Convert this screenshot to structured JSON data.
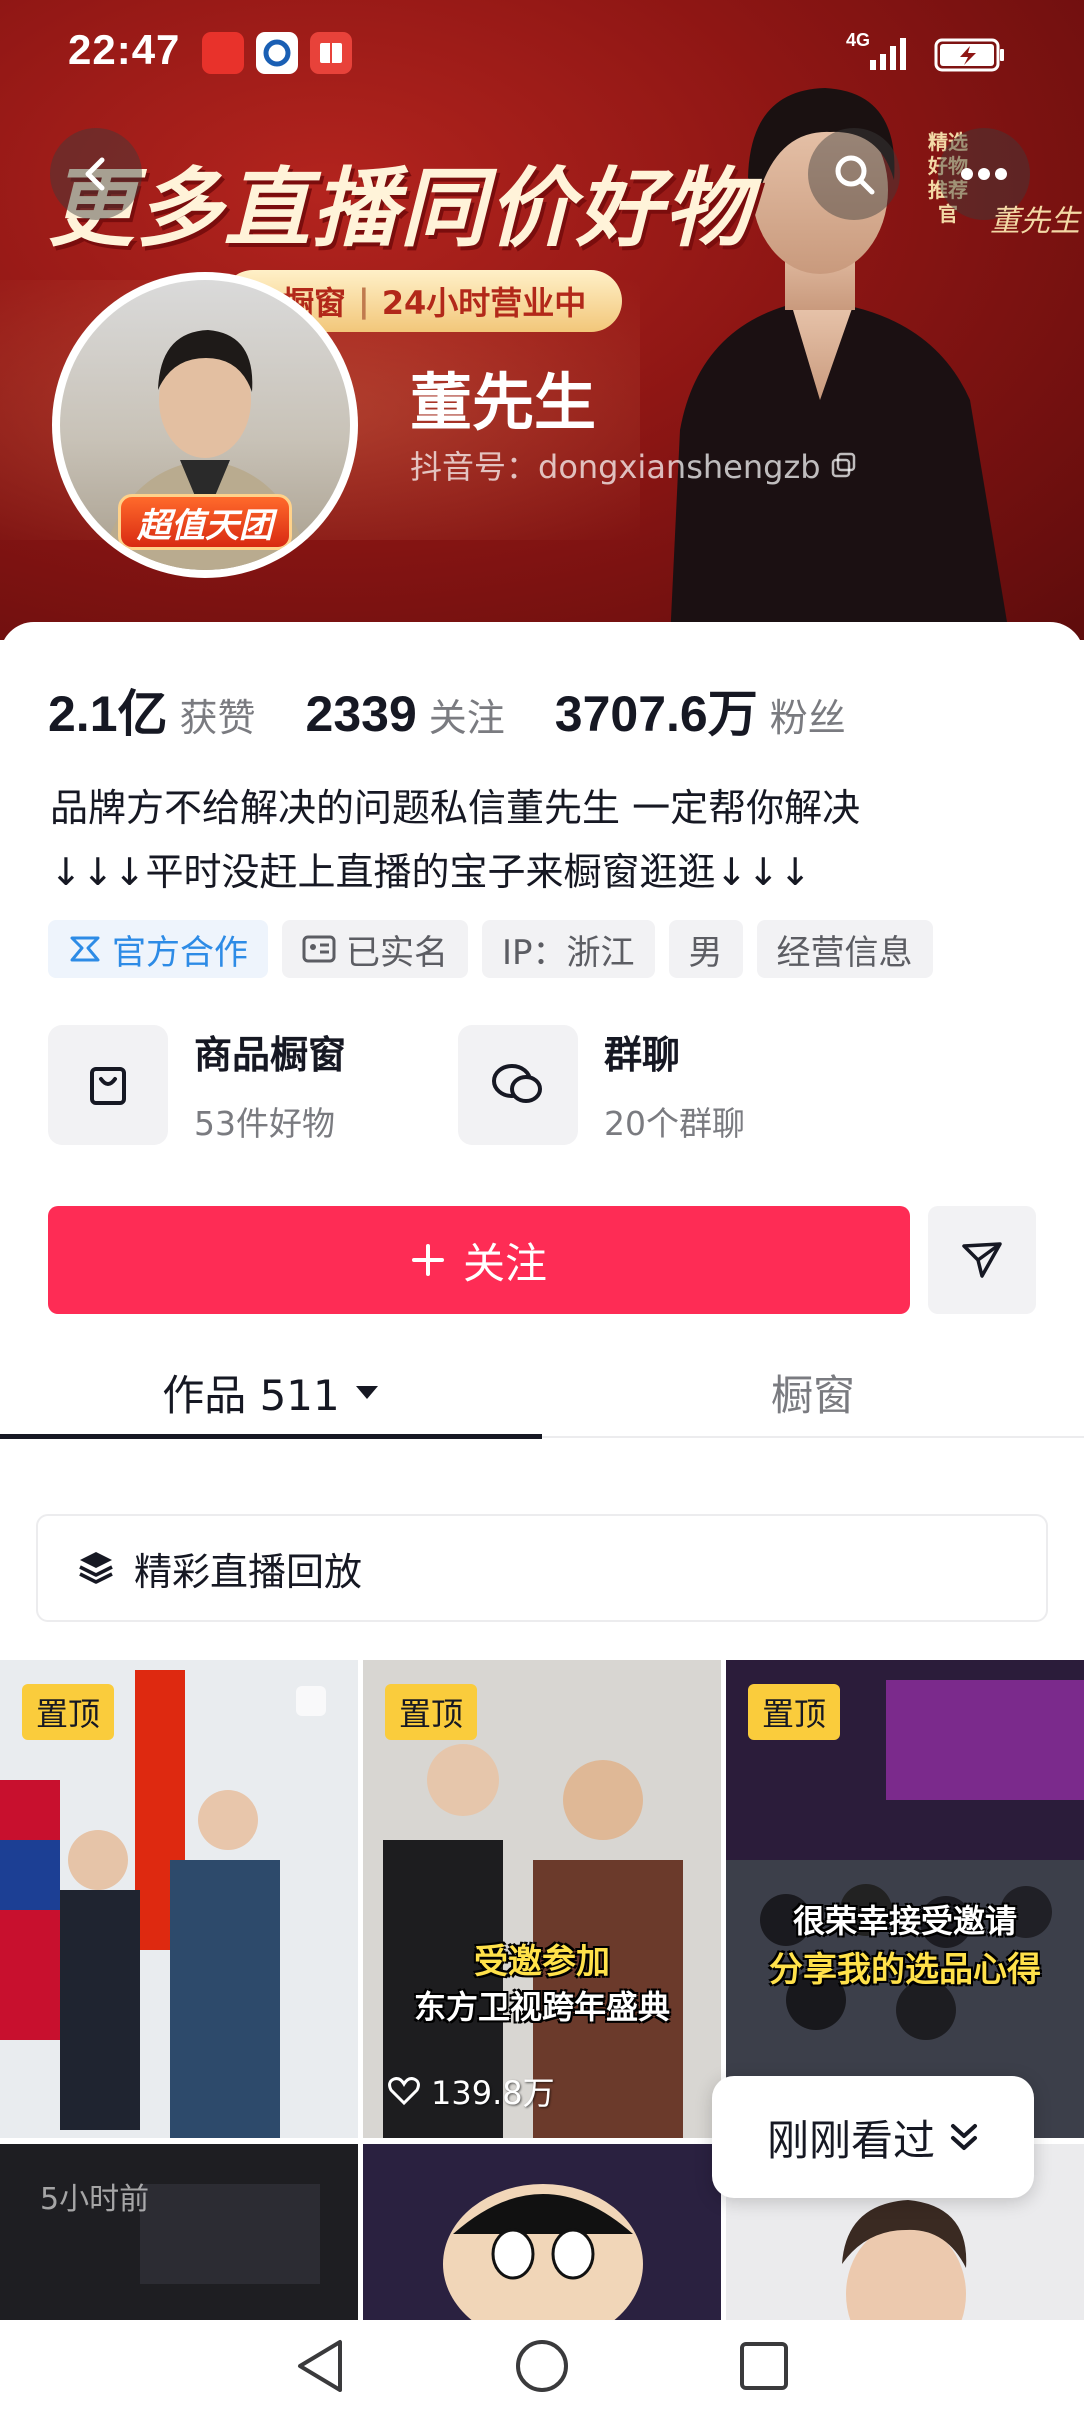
{
  "status_bar": {
    "time": "22:47",
    "network": "4G",
    "apps": [
      "yunpay-icon",
      "bank-icon",
      "book-icon"
    ]
  },
  "banner": {
    "headline": "更多直播同价好物",
    "vertical_tag": "精选好物推荐官",
    "signature": "董先生",
    "shop_pill_left": "橱窗",
    "shop_pill_sep": "|",
    "shop_pill_right": "24小时营业中",
    "avatar_badge": "超值天团"
  },
  "profile": {
    "nickname": "董先生",
    "douyin_id": "抖音号：dongxianshengzb"
  },
  "stats": [
    {
      "num": "2.1亿",
      "label": "获赞"
    },
    {
      "num": "2339",
      "label": "关注"
    },
    {
      "num": "3707.6万",
      "label": "粉丝"
    }
  ],
  "bio": {
    "line1": "品牌方不给解决的问题私信董先生 一定帮你解决",
    "line2": "↓↓↓平时没赶上直播的宝子来橱窗逛逛↓↓↓"
  },
  "tags": {
    "official": "官方合作",
    "verified": "已实名",
    "ip": "IP：浙江",
    "gender": "男",
    "business": "经营信息"
  },
  "entries": {
    "shop_title": "商品橱窗",
    "shop_sub": "53件好物",
    "group_title": "群聊",
    "group_sub": "20个群聊"
  },
  "actions": {
    "follow": "关注"
  },
  "tabs": {
    "works": "作品 511",
    "showcase": "橱窗"
  },
  "replay": {
    "label": "精彩直播回放"
  },
  "videos": [
    {
      "pin": "置顶"
    },
    {
      "pin": "置顶",
      "caption1": "受邀参加",
      "caption2": "东方卫视跨年盛典",
      "likes": "139.8万"
    },
    {
      "pin": "置顶",
      "caption1": "很荣幸接受邀请",
      "caption2": "分享我的选品心得"
    }
  ],
  "row2_overlay": {
    "text_a": "5小时前"
  },
  "recent": {
    "label": "刚刚看过"
  },
  "colors": {
    "accent": "#fe2c55",
    "banner": "#8e1614",
    "pin": "#facc3c"
  }
}
